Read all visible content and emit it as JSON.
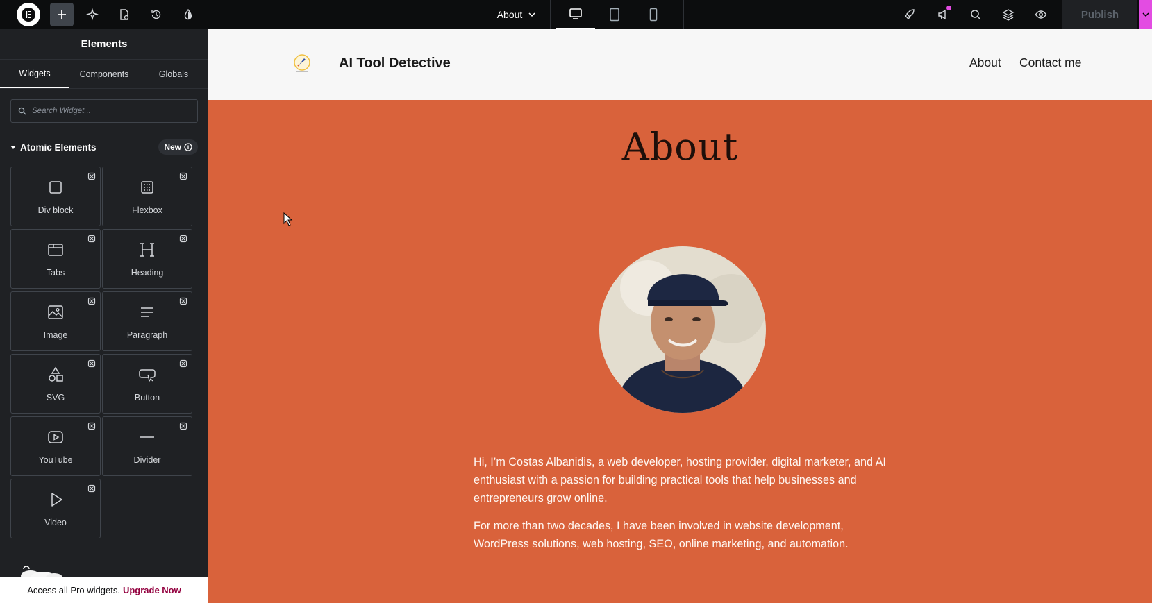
{
  "topbar": {
    "page_selector": "About",
    "publish_label": "Publish"
  },
  "panel": {
    "title": "Elements",
    "tabs": [
      "Widgets",
      "Components",
      "Globals"
    ],
    "search_placeholder": "Search Widget...",
    "category": "Atomic Elements",
    "category_badge": "New",
    "widgets": [
      "Div block",
      "Flexbox",
      "Tabs",
      "Heading",
      "Image",
      "Paragraph",
      "SVG",
      "Button",
      "YouTube",
      "Divider",
      "Video"
    ],
    "promo_text": "Access all Pro widgets.",
    "promo_link": "Upgrade Now"
  },
  "site": {
    "title": "AI Tool Detective",
    "nav": [
      "About",
      "Contact me"
    ],
    "heading": "About",
    "bio": [
      "Hi, I’m Costas Albanidis, a web developer, hosting provider, digital marketer, and AI enthusiast with a passion for building practical tools that help businesses and entrepreneurs grow online.",
      "For more than two decades, I have been involved in website development, WordPress solutions, web hosting, SEO, online marketing, and automation."
    ]
  },
  "colors": {
    "editor_bg": "#0c0d0e",
    "panel_bg": "#1f2124",
    "accent_pink": "#e34ce2",
    "hero_bg": "#d9623b"
  }
}
